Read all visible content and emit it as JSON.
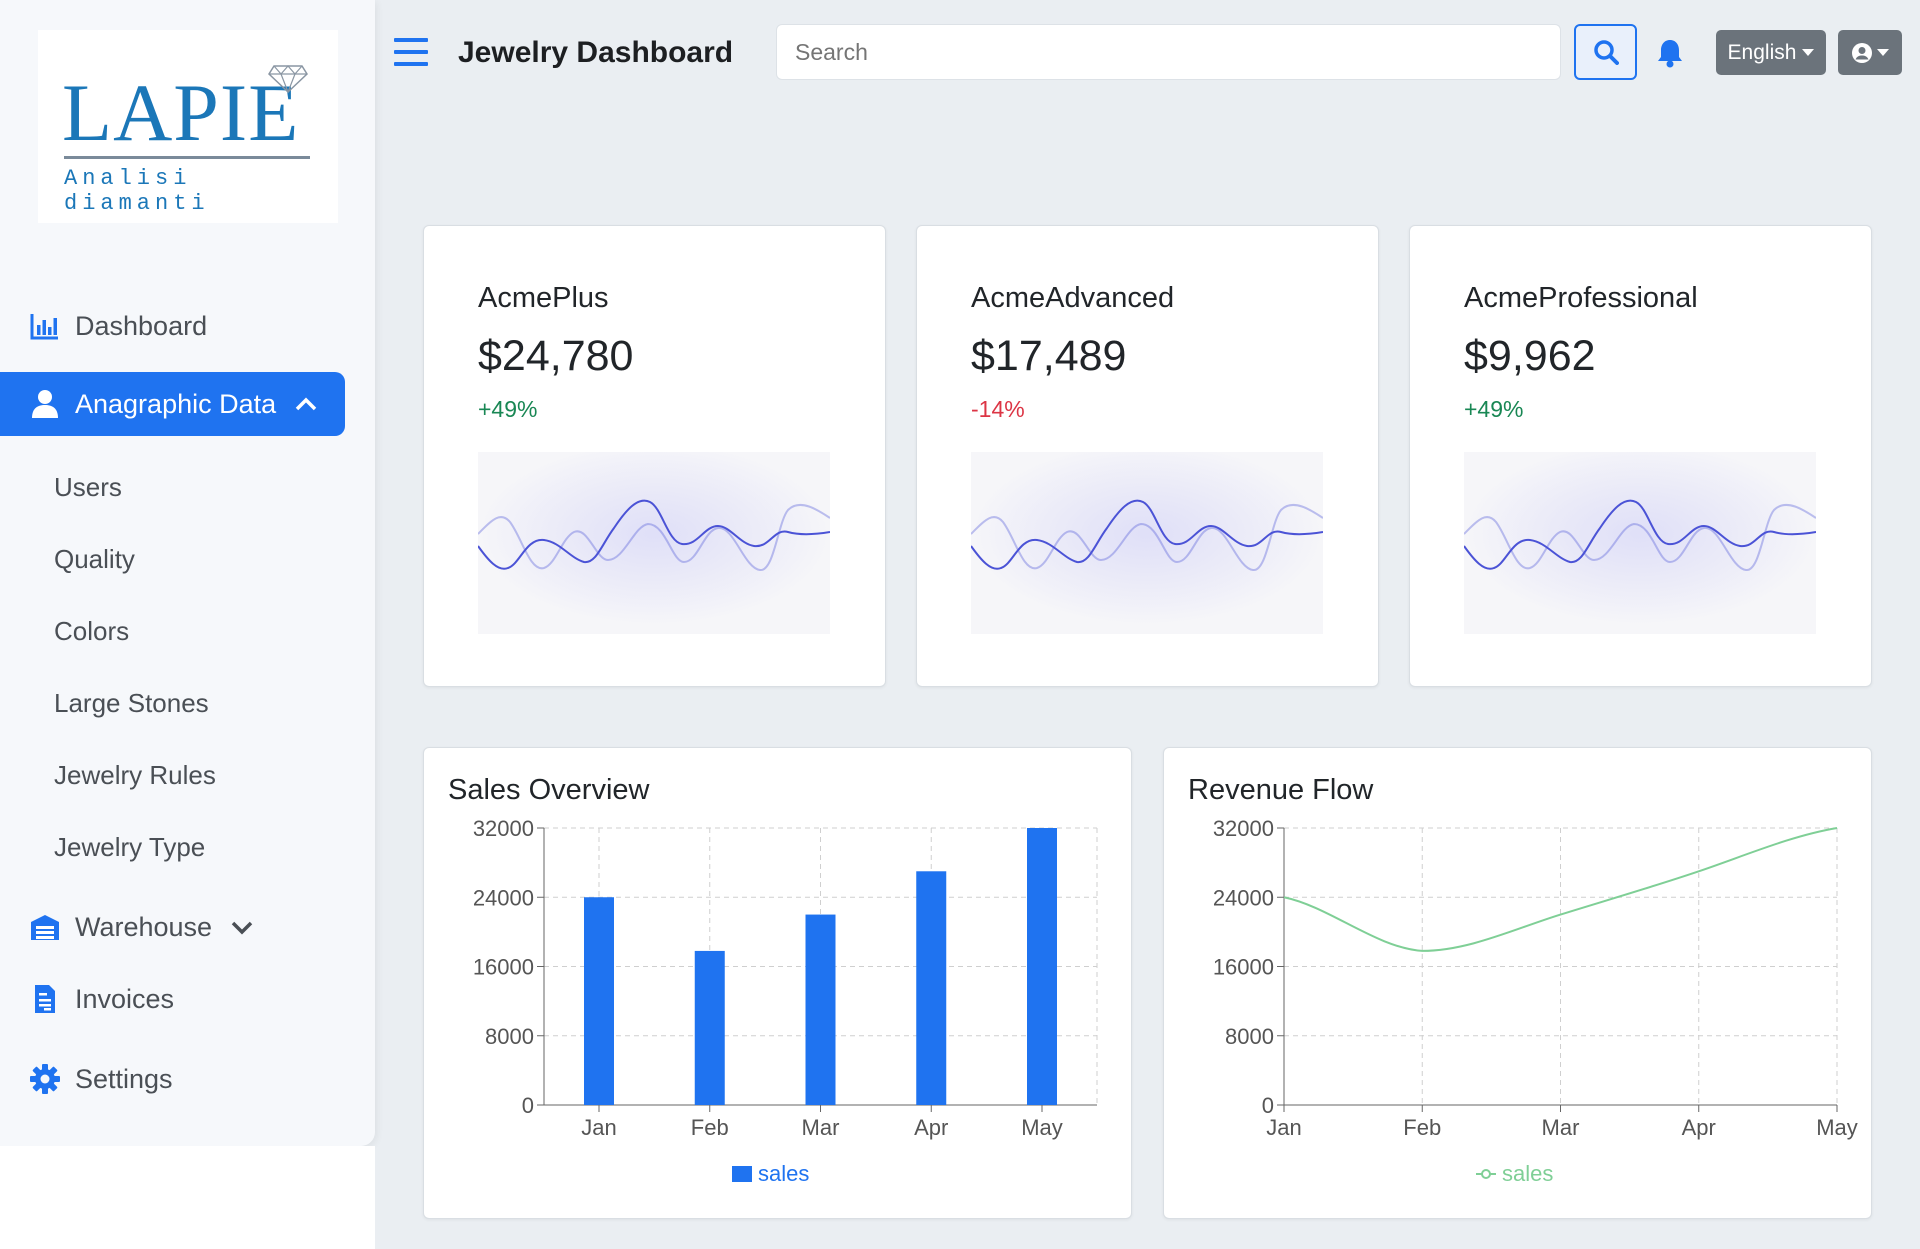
{
  "logo": {
    "word": "LAPIE",
    "tagline": "Analisi diamanti"
  },
  "header": {
    "title": "Jewelry Dashboard",
    "search_placeholder": "Search",
    "language": "English"
  },
  "sidebar": {
    "items": [
      {
        "label": "Dashboard",
        "icon": "bar-chart-icon"
      },
      {
        "label": "Anagraphic Data",
        "icon": "user-icon",
        "expanded": true
      },
      {
        "label": "Warehouse",
        "icon": "warehouse-icon"
      },
      {
        "label": "Invoices",
        "icon": "invoice-icon"
      },
      {
        "label": "Settings",
        "icon": "gear-icon"
      }
    ],
    "subitems": [
      "Users",
      "Quality",
      "Colors",
      "Large Stones",
      "Jewelry Rules",
      "Jewelry Type"
    ]
  },
  "stats": [
    {
      "name": "AcmePlus",
      "value": "$24,780",
      "change": "+49%",
      "trend": "up"
    },
    {
      "name": "AcmeAdvanced",
      "value": "$17,489",
      "change": "-14%",
      "trend": "down"
    },
    {
      "name": "AcmeProfessional",
      "value": "$9,962",
      "change": "+49%",
      "trend": "up"
    }
  ],
  "colors": {
    "primary": "#1f73f0",
    "bar": "#1f73f0",
    "line": "#7fcf96",
    "up": "#198754",
    "down": "#dc3545",
    "spark": "#4b53d6"
  },
  "chart_data": [
    {
      "type": "bar",
      "title": "Sales Overview",
      "categories": [
        "Jan",
        "Feb",
        "Mar",
        "Apr",
        "May"
      ],
      "series": [
        {
          "name": "sales",
          "values": [
            24000,
            17800,
            22000,
            27000,
            32000
          ]
        }
      ],
      "ylim": [
        0,
        32000
      ],
      "yticks": [
        0,
        8000,
        16000,
        24000,
        32000
      ],
      "grid": true,
      "legend": "bottom"
    },
    {
      "type": "line",
      "title": "Revenue Flow",
      "categories": [
        "Jan",
        "Feb",
        "Mar",
        "Apr",
        "May"
      ],
      "series": [
        {
          "name": "sales",
          "values": [
            24000,
            17800,
            22000,
            27000,
            32000
          ]
        }
      ],
      "ylim": [
        0,
        32000
      ],
      "yticks": [
        0,
        8000,
        16000,
        24000,
        32000
      ],
      "grid": true,
      "legend": "bottom"
    }
  ]
}
